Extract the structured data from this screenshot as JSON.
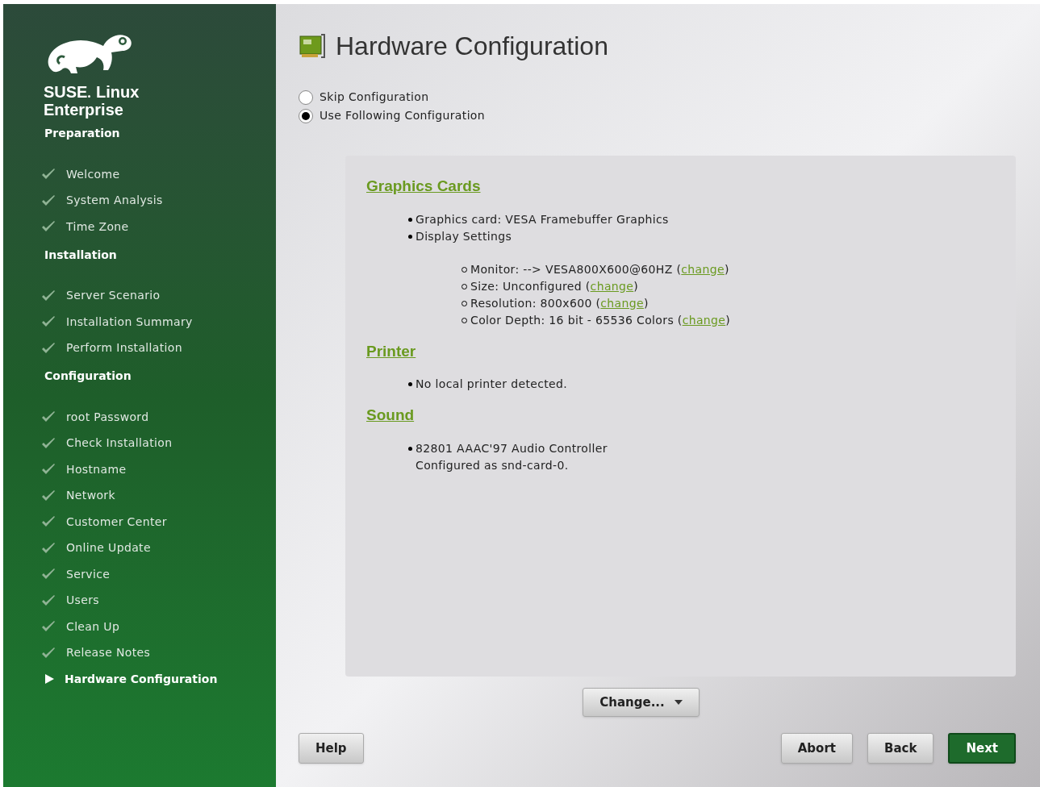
{
  "sidebar": {
    "brand": [
      "SUSE",
      "Linux",
      "Enterprise"
    ],
    "sections": [
      {
        "heading": "Preparation",
        "items": [
          {
            "label": "Welcome",
            "kind": "done"
          },
          {
            "label": "System Analysis",
            "kind": "done"
          },
          {
            "label": "Time Zone",
            "kind": "done"
          }
        ]
      },
      {
        "heading": "Installation",
        "items": [
          {
            "label": "Server Scenario",
            "kind": "done"
          },
          {
            "label": "Installation Summary",
            "kind": "done"
          },
          {
            "label": "Perform Installation",
            "kind": "done"
          }
        ]
      },
      {
        "heading": "Configuration",
        "items": [
          {
            "label": "root Password",
            "kind": "done"
          },
          {
            "label": "Check Installation",
            "kind": "done"
          },
          {
            "label": "Hostname",
            "kind": "done"
          },
          {
            "label": "Network",
            "kind": "done"
          },
          {
            "label": "Customer Center",
            "kind": "done"
          },
          {
            "label": "Online Update",
            "kind": "done"
          },
          {
            "label": "Service",
            "kind": "done"
          },
          {
            "label": "Users",
            "kind": "done"
          },
          {
            "label": "Clean Up",
            "kind": "done"
          },
          {
            "label": "Release Notes",
            "kind": "done"
          },
          {
            "label": "Hardware Configuration",
            "kind": "current"
          }
        ]
      }
    ]
  },
  "title": "Hardware Configuration",
  "options": [
    {
      "label": "Skip Configuration",
      "selected": false
    },
    {
      "label": "Use Following Configuration",
      "selected": true
    }
  ],
  "summary": [
    {
      "heading": "Graphics Cards",
      "items": [
        {
          "lines": [
            "Graphics card: VESA Framebuffer Graphics"
          ]
        },
        {
          "lines": [
            "Display Settings"
          ],
          "children": [
            {
              "before": "Monitor: --> VESA800X600@60HZ (",
              "link": "change",
              "after": ")"
            },
            {
              "before": "Size: Unconfigured (",
              "link": "change",
              "after": ")"
            },
            {
              "before": "Resolution: 800x600 (",
              "link": "change",
              "after": ")"
            },
            {
              "before": "Color Depth: 16 bit - 65536 Colors (",
              "link": "change",
              "after": ")"
            }
          ]
        }
      ]
    },
    {
      "heading": "Printer",
      "items": [
        {
          "lines": [
            "No local printer detected."
          ]
        }
      ]
    },
    {
      "heading": "Sound",
      "items": [
        {
          "lines": [
            "82801 AAAC'97 Audio Controller",
            "Configured as snd-card-0."
          ]
        }
      ]
    }
  ],
  "change_button": "Change...",
  "buttons": [
    {
      "label": "Help",
      "kind": "left"
    },
    {
      "label": "Abort",
      "kind": "normal"
    },
    {
      "label": "Back",
      "kind": "normal"
    },
    {
      "label": "Next",
      "kind": "primary"
    }
  ]
}
